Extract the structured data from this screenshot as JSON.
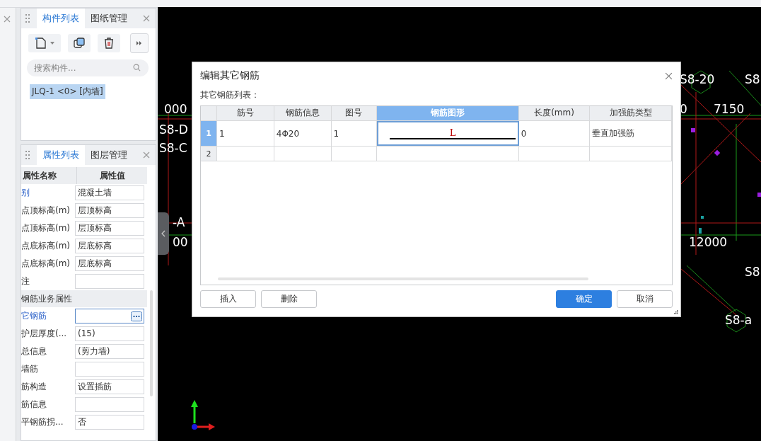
{
  "component_panel": {
    "tabs": [
      {
        "label": "构件列表",
        "selected": true
      },
      {
        "label": "图纸管理",
        "selected": false
      }
    ],
    "search": {
      "placeholder": "搜索构件..."
    },
    "items": [
      {
        "label": "JLQ-1 <0> [内墙]",
        "selected": true
      }
    ]
  },
  "property_panel": {
    "tabs": [
      {
        "label": "属性列表",
        "selected": true
      },
      {
        "label": "图层管理",
        "selected": false
      }
    ],
    "columns": [
      "属性名称",
      "属性值"
    ],
    "rows": [
      {
        "kind": "field",
        "name": "别",
        "value": "混凝土墙",
        "highlighted": true
      },
      {
        "kind": "field",
        "name": "点顶标高(m)",
        "value": "层顶标高",
        "highlighted": false
      },
      {
        "kind": "field",
        "name": "点顶标高(m)",
        "value": "层顶标高",
        "highlighted": false
      },
      {
        "kind": "field",
        "name": "点底标高(m)",
        "value": "层底标高",
        "highlighted": false
      },
      {
        "kind": "field",
        "name": "点底标高(m)",
        "value": "层底标高",
        "highlighted": false
      },
      {
        "kind": "field",
        "name": "注",
        "highlighted": false
      },
      {
        "kind": "group",
        "name": "钢筋业务属性"
      },
      {
        "kind": "picker",
        "name": "它钢筋",
        "highlighted": true
      },
      {
        "kind": "field",
        "name": "护层厚度(...",
        "value": "(15)",
        "highlighted": false
      },
      {
        "kind": "field",
        "name": "总信息",
        "value": "(剪力墙)",
        "highlighted": false
      },
      {
        "kind": "field",
        "name": "墙筋",
        "highlighted": false
      },
      {
        "kind": "field",
        "name": "筋构造",
        "value": "设置插筋",
        "highlighted": false
      },
      {
        "kind": "field",
        "name": "筋信息",
        "highlighted": false
      },
      {
        "kind": "field",
        "name": "平钢筋拐...",
        "value": "否",
        "highlighted": false
      }
    ]
  },
  "canvas": {
    "labels": [
      "S8-20",
      "S8",
      "000",
      "0",
      "7150",
      "S8-D",
      "S8-C",
      "-A",
      "00",
      "12000",
      "S8",
      "S8-a"
    ]
  },
  "dialog": {
    "title": "编辑其它钢筋",
    "list_label": "其它钢筋列表：",
    "columns": [
      {
        "label": "筋号",
        "selected": false
      },
      {
        "label": "钢筋信息",
        "selected": false
      },
      {
        "label": "图号",
        "selected": false
      },
      {
        "label": "钢筋图形",
        "selected": true
      },
      {
        "label": "长度(mm)",
        "selected": false
      },
      {
        "label": "加强筋类型",
        "selected": false
      }
    ],
    "rows": [
      {
        "number": "1",
        "selected": true,
        "bar_no": "1",
        "info": "4Φ20",
        "figure_no": "1",
        "shape_label": "L",
        "length": "0",
        "type": "垂直加强筋"
      },
      {
        "number": "2",
        "selected": false
      }
    ],
    "left_buttons": [
      {
        "label": "插入",
        "primary": false
      },
      {
        "label": "删除",
        "primary": false
      }
    ],
    "right_buttons": [
      {
        "label": "确定",
        "primary": true
      },
      {
        "label": "取消",
        "primary": false
      }
    ]
  }
}
